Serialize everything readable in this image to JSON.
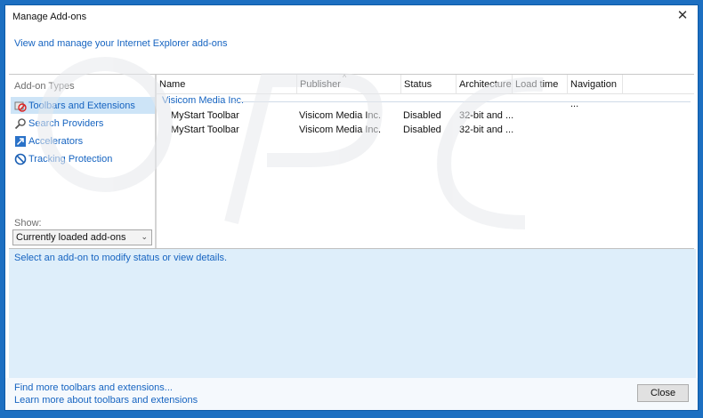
{
  "window": {
    "title": "Manage Add-ons",
    "subtitle": "View and manage your Internet Explorer add-ons"
  },
  "sidebar": {
    "heading": "Add-on Types",
    "items": [
      {
        "label": "Toolbars and Extensions",
        "icon": "toolbars-extensions-icon",
        "selected": true
      },
      {
        "label": "Search Providers",
        "icon": "search-icon",
        "selected": false
      },
      {
        "label": "Accelerators",
        "icon": "accelerators-icon",
        "selected": false
      },
      {
        "label": "Tracking Protection",
        "icon": "tracking-protection-icon",
        "selected": false
      }
    ],
    "show_label": "Show:",
    "show_value": "Currently loaded add-ons"
  },
  "list": {
    "columns": [
      "Name",
      "Publisher",
      "Status",
      "Architecture",
      "Load time",
      "Navigation ..."
    ],
    "group": "Visicom Media Inc.",
    "rows": [
      {
        "name": "MyStart Toolbar",
        "publisher": "Visicom Media Inc.",
        "status": "Disabled",
        "architecture": "32-bit and ..."
      },
      {
        "name": "MyStart Toolbar",
        "publisher": "Visicom Media Inc.",
        "status": "Disabled",
        "architecture": "32-bit and ..."
      }
    ]
  },
  "details": {
    "prompt": "Select an add-on to modify status or view details."
  },
  "footer": {
    "link1": "Find more toolbars and extensions...",
    "link2": "Learn more about toolbars and extensions",
    "close_label": "Close"
  },
  "colors": {
    "accent": "#1664c1",
    "frame": "#1c6fc1",
    "selection": "#cde4f7",
    "details_bg": "#deeefa"
  }
}
